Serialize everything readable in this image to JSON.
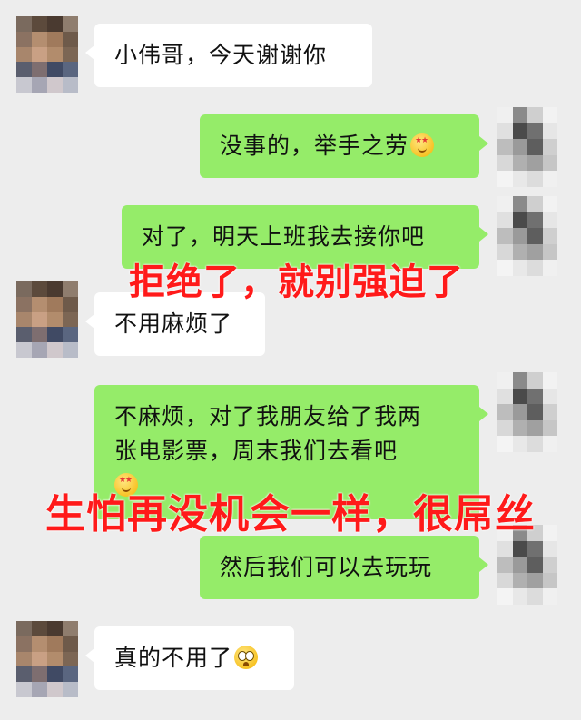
{
  "chat": {
    "messages": [
      {
        "side": "left",
        "text": "小伟哥，今天谢谢你"
      },
      {
        "side": "right",
        "text": "没事的，举手之劳",
        "emoji": "star-struck-face-icon"
      },
      {
        "side": "right",
        "text": "对了，明天上班我去接你吧"
      },
      {
        "side": "left",
        "text": "不用麻烦了"
      },
      {
        "side": "right",
        "line1": "不麻烦，对了我朋友给了我两",
        "line2": "张电影票，周末我们去看吧",
        "emoji": "star-struck-face-icon"
      },
      {
        "side": "right",
        "text": "然后我们可以去玩玩"
      },
      {
        "side": "left",
        "text": "真的不用了",
        "emoji": "pleading-face-icon"
      }
    ]
  },
  "captions": {
    "caption1": "拒绝了，就别强迫了",
    "caption2": "生怕再没机会一样，很屌丝"
  },
  "colors": {
    "background": "#ededed",
    "left_bubble": "#ffffff",
    "right_bubble": "#95ec69",
    "caption": "#ff1a1a"
  }
}
